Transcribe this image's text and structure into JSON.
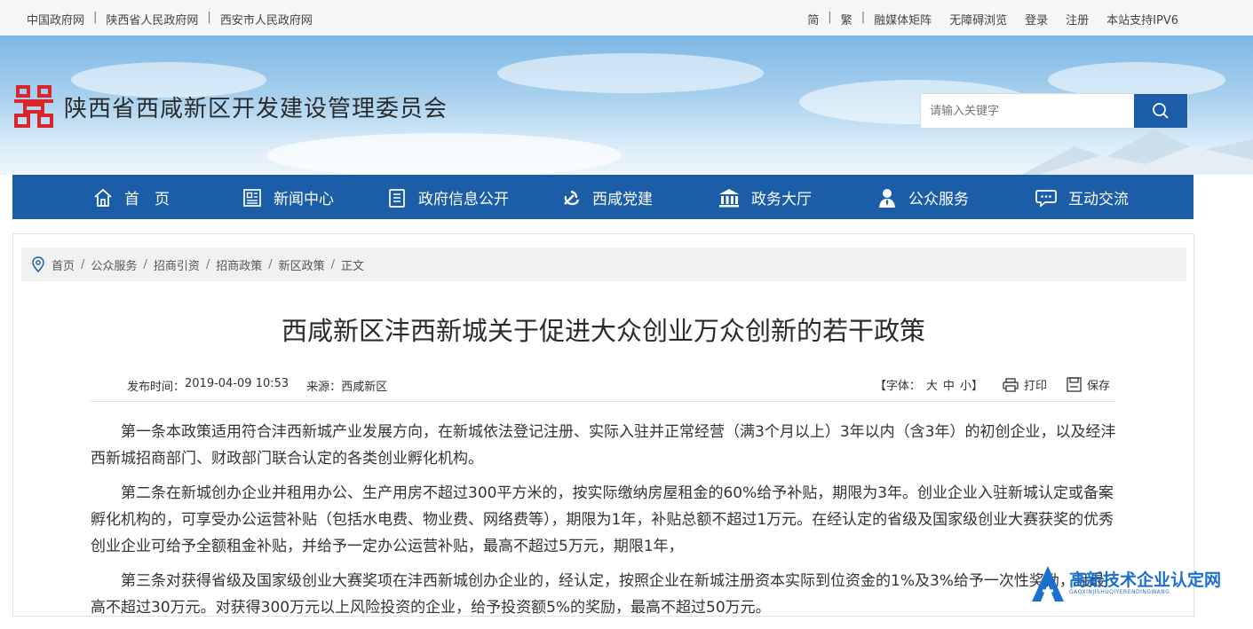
{
  "topbar": {
    "left_links": [
      "中国政府网",
      "陕西省人民政府网",
      "西安市人民政府网"
    ],
    "right_links": [
      "简",
      "繁",
      "融媒体矩阵",
      "无障碍浏览",
      "登录",
      "注册",
      "本站支持IPV6"
    ]
  },
  "header": {
    "site_title": "陕西省西咸新区开发建设管理委员会",
    "search_placeholder": "请输入关键字"
  },
  "nav": {
    "items": [
      {
        "label": "首　页",
        "icon": "home-icon"
      },
      {
        "label": "新闻中心",
        "icon": "news-icon"
      },
      {
        "label": "政府信息公开",
        "icon": "document-list-icon"
      },
      {
        "label": "西咸党建",
        "icon": "party-emblem-icon"
      },
      {
        "label": "政务大厅",
        "icon": "government-building-icon"
      },
      {
        "label": "公众服务",
        "icon": "person-icon"
      },
      {
        "label": "互动交流",
        "icon": "chat-bubble-icon"
      }
    ]
  },
  "breadcrumb": {
    "items": [
      "首页",
      "公众服务",
      "招商引资",
      "招商政策",
      "新区政策",
      "正文"
    ]
  },
  "article": {
    "title": "西咸新区沣西新城关于促进大众创业万众创新的若干政策",
    "publish_label": "发布时间：",
    "publish_time": "2019-04-09 10:53",
    "source_label": "来源：",
    "source": "西咸新区",
    "font_label_open": "【字体：",
    "font_sizes": [
      "大",
      "中",
      "小"
    ],
    "font_label_close": "】",
    "print_label": "打印",
    "save_label": "保存",
    "paragraphs": [
      "第一条本政策适用符合沣西新城产业发展方向，在新城依法登记注册、实际入驻并正常经营（满3个月以上）3年以内（含3年）的初创企业，以及经沣西新城招商部门、财政部门联合认定的各类创业孵化机构。",
      "第二条在新城创办企业并租用办公、生产用房不超过300平方米的，按实际缴纳房屋租金的60%给予补贴，期限为3年。创业企业入驻新城认定或备案孵化机构的，可享受办公运营补贴（包括水电费、物业费、网络费等），期限为1年，补贴总额不超过1万元。在经认定的省级及国家级创业大赛获奖的优秀创业企业可给予全额租金补贴，并给予一定办公运营补贴，最高不超过5万元，期限1年，",
      "第三条对获得省级及国家级创业大赛奖项在沣西新城创办企业的，经认定，按照企业在新城注册资本实际到位资金的1%及3%给予一次性奖励，且最高不超过30万元。对获得300万元以上风险投资的企业，给予投资额5%的奖励，最高不超过50万元。"
    ]
  },
  "watermark": {
    "main": "高新技术企业认定网",
    "sub": "GAOXINJISHUQIYERENDINGWANG"
  },
  "colors": {
    "nav_bg": "#1b5ea7",
    "logo_red": "#d7262e"
  }
}
